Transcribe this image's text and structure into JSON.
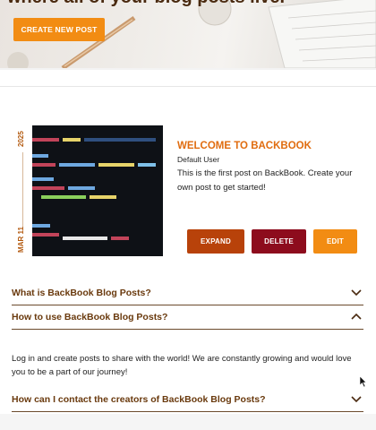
{
  "hero": {
    "headline": "where all of your blog posts live.",
    "create_button": "CREATE NEW POST"
  },
  "post": {
    "date_year": "2025",
    "date_month_day": "MAR 11",
    "title": "WELCOME TO BACKBOOK",
    "author": "Default User",
    "body": "This is the first post on BackBook. Create your own post to get started!",
    "buttons": {
      "expand": "EXPAND",
      "delete": "DELETE",
      "edit": "EDIT"
    }
  },
  "faq": {
    "items": [
      {
        "question": "What is BackBook Blog Posts?",
        "state": "collapsed"
      },
      {
        "question": "How to use BackBook Blog Posts?",
        "state": "expanded",
        "answer": "Log in and create posts to share with the world! We are constantly growing and would love you to be a part of our journey!"
      },
      {
        "question": "How can I contact the creators of BackBook Blog Posts?",
        "state": "collapsed"
      }
    ]
  },
  "colors": {
    "accent": "#f28c13",
    "expand": "#b8420a",
    "delete": "#8d0c1d",
    "title": "#e06c0f",
    "faq_text": "#6a3a0e"
  }
}
